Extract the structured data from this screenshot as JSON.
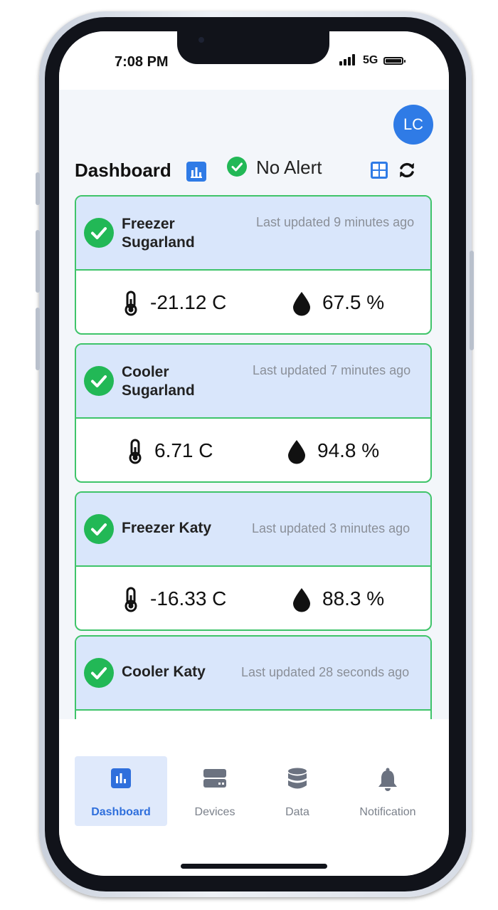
{
  "status_bar": {
    "time": "7:08 PM",
    "network": "5G"
  },
  "user": {
    "initials": "LC"
  },
  "header": {
    "title": "Dashboard",
    "alert_status": "No Alert"
  },
  "devices": [
    {
      "name": "Freezer Sugarland",
      "updated": "Last updated 9 minutes ago",
      "temperature": "-21.12 C",
      "humidity": "67.5 %"
    },
    {
      "name": "Cooler Sugarland",
      "updated": "Last updated 7 minutes ago",
      "temperature": "6.71 C",
      "humidity": "94.8 %"
    },
    {
      "name": "Freezer Katy",
      "updated": "Last updated 3 minutes ago",
      "temperature": "-16.33 C",
      "humidity": "88.3 %"
    },
    {
      "name": "Cooler Katy",
      "updated": "Last updated 28 seconds ago",
      "temperature": "",
      "humidity": ""
    }
  ],
  "nav": [
    {
      "label": "Dashboard",
      "icon": "bar-chart-icon",
      "active": true
    },
    {
      "label": "Devices",
      "icon": "server-icon",
      "active": false
    },
    {
      "label": "Data",
      "icon": "database-icon",
      "active": false
    },
    {
      "label": "Notification",
      "icon": "bell-icon",
      "active": false
    }
  ],
  "colors": {
    "accent": "#2f7be6",
    "success": "#22b856",
    "card_header": "#d9e6fb",
    "card_border": "#3fc46a"
  }
}
